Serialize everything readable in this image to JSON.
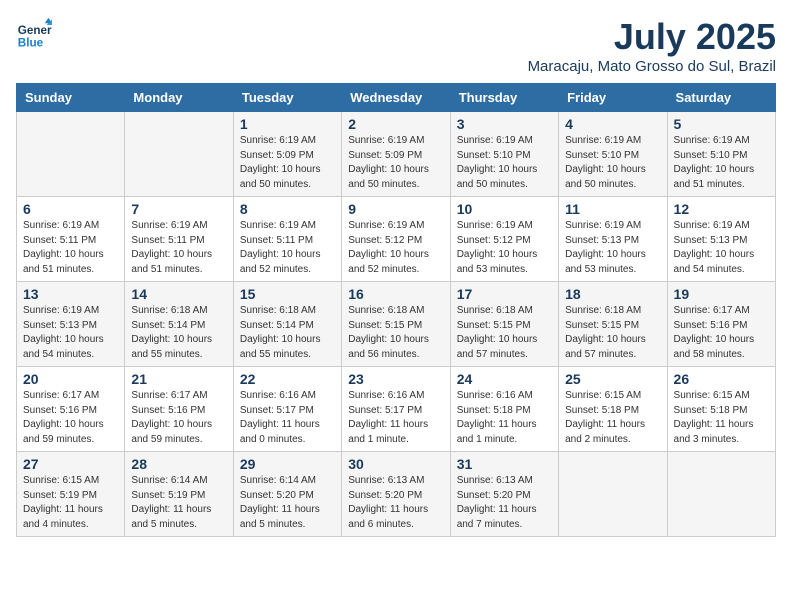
{
  "header": {
    "logo_line1": "General",
    "logo_line2": "Blue",
    "month_year": "July 2025",
    "location": "Maracaju, Mato Grosso do Sul, Brazil"
  },
  "weekdays": [
    "Sunday",
    "Monday",
    "Tuesday",
    "Wednesday",
    "Thursday",
    "Friday",
    "Saturday"
  ],
  "weeks": [
    [
      {
        "day": "",
        "info": ""
      },
      {
        "day": "",
        "info": ""
      },
      {
        "day": "1",
        "info": "Sunrise: 6:19 AM\nSunset: 5:09 PM\nDaylight: 10 hours\nand 50 minutes."
      },
      {
        "day": "2",
        "info": "Sunrise: 6:19 AM\nSunset: 5:09 PM\nDaylight: 10 hours\nand 50 minutes."
      },
      {
        "day": "3",
        "info": "Sunrise: 6:19 AM\nSunset: 5:10 PM\nDaylight: 10 hours\nand 50 minutes."
      },
      {
        "day": "4",
        "info": "Sunrise: 6:19 AM\nSunset: 5:10 PM\nDaylight: 10 hours\nand 50 minutes."
      },
      {
        "day": "5",
        "info": "Sunrise: 6:19 AM\nSunset: 5:10 PM\nDaylight: 10 hours\nand 51 minutes."
      }
    ],
    [
      {
        "day": "6",
        "info": "Sunrise: 6:19 AM\nSunset: 5:11 PM\nDaylight: 10 hours\nand 51 minutes."
      },
      {
        "day": "7",
        "info": "Sunrise: 6:19 AM\nSunset: 5:11 PM\nDaylight: 10 hours\nand 51 minutes."
      },
      {
        "day": "8",
        "info": "Sunrise: 6:19 AM\nSunset: 5:11 PM\nDaylight: 10 hours\nand 52 minutes."
      },
      {
        "day": "9",
        "info": "Sunrise: 6:19 AM\nSunset: 5:12 PM\nDaylight: 10 hours\nand 52 minutes."
      },
      {
        "day": "10",
        "info": "Sunrise: 6:19 AM\nSunset: 5:12 PM\nDaylight: 10 hours\nand 53 minutes."
      },
      {
        "day": "11",
        "info": "Sunrise: 6:19 AM\nSunset: 5:13 PM\nDaylight: 10 hours\nand 53 minutes."
      },
      {
        "day": "12",
        "info": "Sunrise: 6:19 AM\nSunset: 5:13 PM\nDaylight: 10 hours\nand 54 minutes."
      }
    ],
    [
      {
        "day": "13",
        "info": "Sunrise: 6:19 AM\nSunset: 5:13 PM\nDaylight: 10 hours\nand 54 minutes."
      },
      {
        "day": "14",
        "info": "Sunrise: 6:18 AM\nSunset: 5:14 PM\nDaylight: 10 hours\nand 55 minutes."
      },
      {
        "day": "15",
        "info": "Sunrise: 6:18 AM\nSunset: 5:14 PM\nDaylight: 10 hours\nand 55 minutes."
      },
      {
        "day": "16",
        "info": "Sunrise: 6:18 AM\nSunset: 5:15 PM\nDaylight: 10 hours\nand 56 minutes."
      },
      {
        "day": "17",
        "info": "Sunrise: 6:18 AM\nSunset: 5:15 PM\nDaylight: 10 hours\nand 57 minutes."
      },
      {
        "day": "18",
        "info": "Sunrise: 6:18 AM\nSunset: 5:15 PM\nDaylight: 10 hours\nand 57 minutes."
      },
      {
        "day": "19",
        "info": "Sunrise: 6:17 AM\nSunset: 5:16 PM\nDaylight: 10 hours\nand 58 minutes."
      }
    ],
    [
      {
        "day": "20",
        "info": "Sunrise: 6:17 AM\nSunset: 5:16 PM\nDaylight: 10 hours\nand 59 minutes."
      },
      {
        "day": "21",
        "info": "Sunrise: 6:17 AM\nSunset: 5:16 PM\nDaylight: 10 hours\nand 59 minutes."
      },
      {
        "day": "22",
        "info": "Sunrise: 6:16 AM\nSunset: 5:17 PM\nDaylight: 11 hours\nand 0 minutes."
      },
      {
        "day": "23",
        "info": "Sunrise: 6:16 AM\nSunset: 5:17 PM\nDaylight: 11 hours\nand 1 minute."
      },
      {
        "day": "24",
        "info": "Sunrise: 6:16 AM\nSunset: 5:18 PM\nDaylight: 11 hours\nand 1 minute."
      },
      {
        "day": "25",
        "info": "Sunrise: 6:15 AM\nSunset: 5:18 PM\nDaylight: 11 hours\nand 2 minutes."
      },
      {
        "day": "26",
        "info": "Sunrise: 6:15 AM\nSunset: 5:18 PM\nDaylight: 11 hours\nand 3 minutes."
      }
    ],
    [
      {
        "day": "27",
        "info": "Sunrise: 6:15 AM\nSunset: 5:19 PM\nDaylight: 11 hours\nand 4 minutes."
      },
      {
        "day": "28",
        "info": "Sunrise: 6:14 AM\nSunset: 5:19 PM\nDaylight: 11 hours\nand 5 minutes."
      },
      {
        "day": "29",
        "info": "Sunrise: 6:14 AM\nSunset: 5:20 PM\nDaylight: 11 hours\nand 5 minutes."
      },
      {
        "day": "30",
        "info": "Sunrise: 6:13 AM\nSunset: 5:20 PM\nDaylight: 11 hours\nand 6 minutes."
      },
      {
        "day": "31",
        "info": "Sunrise: 6:13 AM\nSunset: 5:20 PM\nDaylight: 11 hours\nand 7 minutes."
      },
      {
        "day": "",
        "info": ""
      },
      {
        "day": "",
        "info": ""
      }
    ]
  ]
}
